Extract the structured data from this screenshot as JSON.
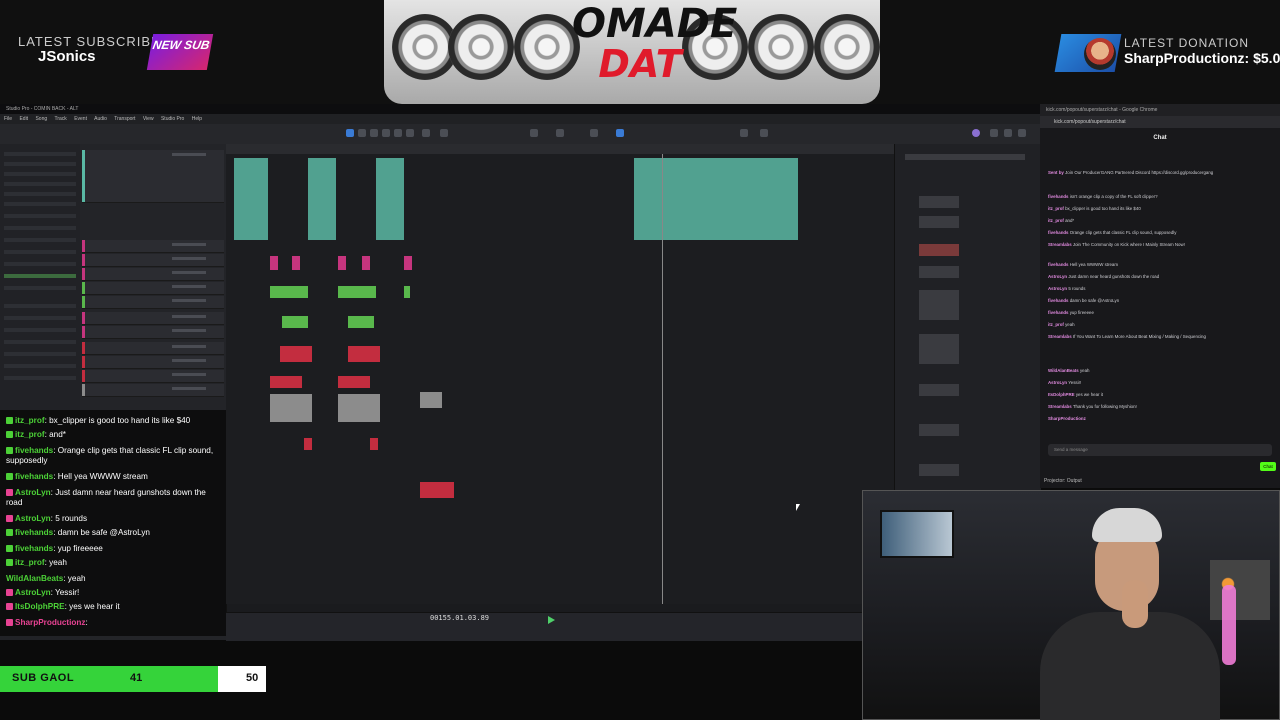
{
  "overlay": {
    "latest_subscriber_label": "LATEST SUBSCRIBER",
    "latest_subscriber_name": "JSonics",
    "new_sub_badge": "NEW SUB",
    "logo_line1": "OMADE",
    "logo_line2": "DAT",
    "latest_donation_label": "LATEST DONATION",
    "latest_donation_value": "SharpProductionz: $5.0"
  },
  "daw": {
    "window_title": "Studio Pro - COMIN BACK - ALT",
    "menu": [
      "File",
      "Edit",
      "Song",
      "Track",
      "Event",
      "Audio",
      "Transport",
      "View",
      "Studio Pro",
      "Help"
    ],
    "time_display": "00155.01.03.89"
  },
  "chat_window": {
    "title": "kick.com/popout/superstarz/chat - Google Chrome",
    "url": "kick.com/popout/superstarz/chat",
    "header": "Chat",
    "messages": [
      {
        "user": "Sent by",
        "text": "Join Our ProducerGANG Partnered Discord https://discord.gg/producergang"
      },
      {
        "user": "fivehands",
        "text": "isn't orange clip a copy of the FL soft clipper?"
      },
      {
        "user": "itz_prof",
        "text": "bx_clipper is good too hand its like $40"
      },
      {
        "user": "itz_prof",
        "text": "and*"
      },
      {
        "user": "fivehands",
        "text": "Orange clip gets that classic FL clip sound, supposedly"
      },
      {
        "user": "Streamlabs",
        "text": "Join The Community on Kick where I Mainly Stream Now!"
      },
      {
        "user": "fivehands",
        "text": "Hell yea WWWW stream"
      },
      {
        "user": "AstroLyn",
        "text": "Just damn near heard gunshots down the road"
      },
      {
        "user": "AstroLyn",
        "text": "5 rounds"
      },
      {
        "user": "fivehands",
        "text": "damn be safe @AstroLyn"
      },
      {
        "user": "fivehands",
        "text": "yup fireeeee"
      },
      {
        "user": "itz_prof",
        "text": "yeah"
      },
      {
        "user": "Streamlabs",
        "text": "If You Want To Learn More About Beat Mixing / Making / Sequencing"
      },
      {
        "user": "WildAlanBeats",
        "text": "yeah"
      },
      {
        "user": "AstroLyn",
        "text": "Yessir!"
      },
      {
        "user": "ItsDolphPRE",
        "text": "yes we hear it"
      },
      {
        "user": "Streamlabs",
        "text": "Thank you for following Myshion!"
      },
      {
        "user": "SharpProductionz",
        "text": ""
      }
    ],
    "input_placeholder": "Send a message",
    "send_label": "Chat",
    "projector_label": "Projector: Output"
  },
  "overlay_chat": {
    "lines": [
      {
        "user": "itz_prof",
        "text": ": bx_clipper is good too hand its like $40"
      },
      {
        "user": "itz_prof",
        "text": ": and*"
      },
      {
        "user": "fivehands",
        "text": ": Orange clip gets that classic FL clip sound, supposedly"
      },
      {
        "user": "fivehands",
        "text": ": Hell yea WWWW stream"
      },
      {
        "user": "AstroLyn",
        "text": ": Just damn near heard gunshots down the road"
      },
      {
        "user": "AstroLyn",
        "text": ": 5 rounds"
      },
      {
        "user": "fivehands",
        "text": ": damn be safe @AstroLyn"
      },
      {
        "user": "fivehands",
        "text": ": yup fireeeee"
      },
      {
        "user": "itz_prof",
        "text": ": yeah"
      },
      {
        "user": "WildAlanBeats",
        "text": ": yeah"
      },
      {
        "user": "AstroLyn",
        "text": ": Yessir!"
      },
      {
        "user": "ItsDolphPRE",
        "text": ": yes we hear it"
      },
      {
        "user": "SharpProductionz",
        "text": ":"
      }
    ]
  },
  "sub_goal": {
    "label": "SUB GAOL",
    "current": "41",
    "target": "50",
    "progress_fraction": 0.82
  },
  "colors": {
    "goal_fill": "#35d33a",
    "username_green": "#4cd137",
    "kick_green": "#53fc18",
    "clip_teal": "#5ab9a5",
    "clip_pink": "#c6357e",
    "clip_red": "#c32d3f"
  }
}
